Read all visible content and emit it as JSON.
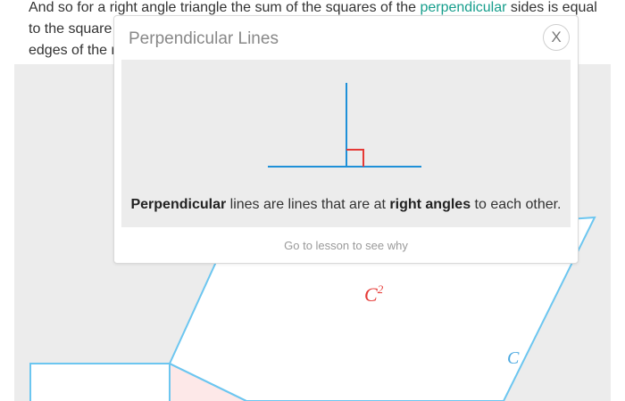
{
  "lesson": {
    "line1_before": "And so for a right angle triangle the sum of the squares of the ",
    "link_text": "perpendicular",
    "line1_after": " sides is equal",
    "line2_start": "to the square",
    "line3_start": "edges of the r"
  },
  "popup": {
    "title": "Perpendicular Lines",
    "close_label": "X",
    "definition": {
      "term": "Perpendicular",
      "mid": " lines are lines that are at ",
      "emphasis": "right angles",
      "end": " to each other."
    },
    "lesson_link": "Go to lesson to see why"
  },
  "diagram": {
    "square_label": "C",
    "square_exponent": "2",
    "side_label": "C"
  },
  "colors": {
    "accent_link": "#169e8c",
    "shape_stroke": "#6cc6f0",
    "label_red": "#e53935",
    "line_blue": "#1e90d8",
    "right_angle_red": "#e53935",
    "triangle_fill": "#fde8e8"
  },
  "icons": {
    "close": "close-icon",
    "perpendicular_diagram": "perpendicular-lines-icon"
  }
}
